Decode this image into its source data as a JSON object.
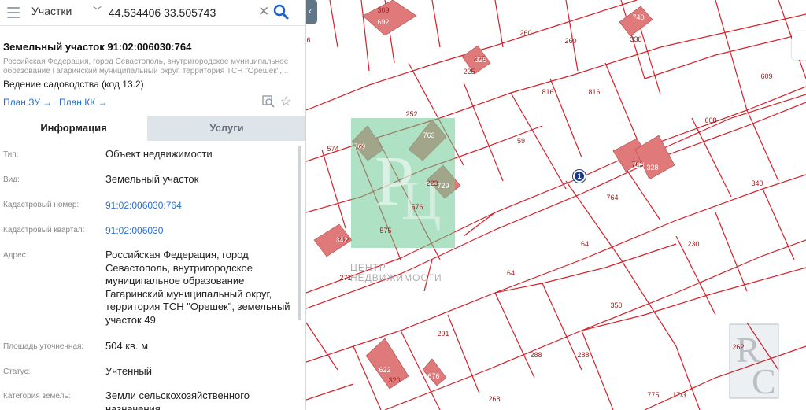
{
  "search": {
    "layer_label": "Участки",
    "query": "44.534406 33.505743"
  },
  "parcel": {
    "title": "Земельный участок 91:02:006030:764",
    "address_short": "Российская Федерация, город Севастополь, внутригородское муниципальное образование Гагаринский муниципальный округ, территория ТСН \"Орешек\",...",
    "use": "Ведение садоводства (код 13.2)",
    "plan_zu": "План ЗУ →",
    "plan_kk": "План КК →"
  },
  "tabs": {
    "info": "Информация",
    "services": "Услуги"
  },
  "info": {
    "type_label": "Тип:",
    "type_value": "Объект недвижимости",
    "kind_label": "Вид:",
    "kind_value": "Земельный участок",
    "cad_label": "Кадастровый номер:",
    "cad_value": "91:02:006030:764",
    "quarter_label": "Кадастровый квартал:",
    "quarter_value": "91:02:006030",
    "address_label": "Адрес:",
    "address_value": "Российская Федерация, город Севастополь, внутригородское муниципальное образование Гагаринский муниципальный округ, территория ТСН \"Орешек\", земельный участок 49",
    "area_label": "Площадь уточненная:",
    "area_value": "504 кв. м",
    "status_label": "Статус:",
    "status_value": "Учтенный",
    "category_label": "Категория земель:",
    "category_value": "Земли сельскохозяйственного назначения"
  },
  "map": {
    "marker_label": "1",
    "watermark_text": "ЦЕНТР НЕДВИЖИМОСТИ",
    "plot_labels": [
      "6",
      "309",
      "260",
      "260",
      "338",
      "325",
      "225",
      "816",
      "816",
      "609",
      "252",
      "608",
      "574",
      "59",
      "728",
      "763",
      "223",
      "340",
      "576",
      "764",
      "575",
      "342",
      "64",
      "230",
      "271",
      "64",
      "350",
      "291",
      "288",
      "288",
      "268",
      "320",
      "775",
      "17/3",
      "262"
    ],
    "building_labels": [
      "692",
      "740",
      "325",
      "728",
      "328",
      "769",
      "763",
      "729",
      "342",
      "622",
      "676"
    ]
  },
  "colors": {
    "accent": "#2a6fd6",
    "boundary": "#d4202a",
    "building": "#e07a7a",
    "tab_inactive": "#dde4ea"
  },
  "icons": [
    "menu-icon",
    "chevron-down-icon",
    "clear-icon",
    "search-icon",
    "collapse-icon",
    "zoom-to-icon",
    "star-icon",
    "marker-icon"
  ]
}
